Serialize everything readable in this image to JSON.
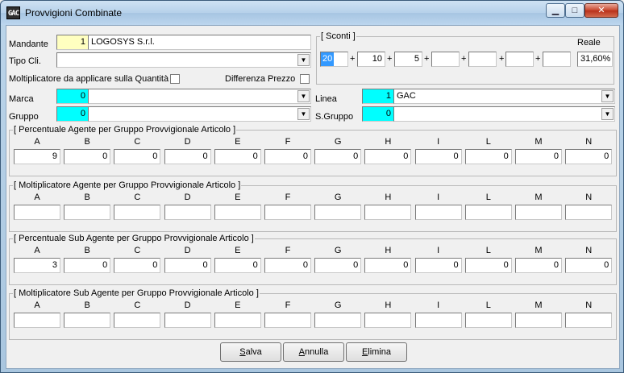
{
  "window": {
    "title": "Provvigioni Combinate",
    "icon_text": "GAC",
    "minimize_glyph": "▁",
    "maximize_glyph": "□",
    "close_glyph": "✕"
  },
  "mandante": {
    "label": "Mandante",
    "code": "1",
    "name": "LOGOSYS S.r.l."
  },
  "tipo_cli": {
    "label": "Tipo Cli.",
    "value": ""
  },
  "moltiplicatore_quantita": {
    "label": "Moltiplicatore da applicare sulla Quantità",
    "checked": false
  },
  "differenza_prezzo": {
    "label": "Differenza Prezzo",
    "checked": false
  },
  "sconti": {
    "title": "[ Sconti ]",
    "reale_label": "Reale",
    "values": [
      "20",
      "10",
      "5",
      "",
      "",
      "",
      ""
    ],
    "plus": "+",
    "reale_value": "31,60%"
  },
  "marca": {
    "label": "Marca",
    "code": "0",
    "name": ""
  },
  "linea": {
    "label": "Linea",
    "code": "1",
    "name": "GAC"
  },
  "gruppo": {
    "label": "Gruppo",
    "code": "0",
    "name": ""
  },
  "sgruppo": {
    "label": "S.Gruppo",
    "code": "0",
    "name": ""
  },
  "columns": [
    "A",
    "B",
    "C",
    "D",
    "E",
    "F",
    "G",
    "H",
    "I",
    "L",
    "M",
    "N"
  ],
  "groups": [
    {
      "title": "[ Percentuale Agente per Gruppo Provvigionale Articolo ]",
      "values": [
        "9",
        "0",
        "0",
        "0",
        "0",
        "0",
        "0",
        "0",
        "0",
        "0",
        "0",
        "0"
      ]
    },
    {
      "title": "[ Moltiplicatore Agente per Gruppo Provvigionale Articolo ]",
      "values": [
        "",
        "",
        "",
        "",
        "",
        "",
        "",
        "",
        "",
        "",
        "",
        ""
      ]
    },
    {
      "title": "[ Percentuale Sub Agente per Gruppo Provvigionale Articolo ]",
      "values": [
        "3",
        "0",
        "0",
        "0",
        "0",
        "0",
        "0",
        "0",
        "0",
        "0",
        "0",
        "0"
      ]
    },
    {
      "title": "[ Moltiplicatore Sub Agente per Gruppo Provvigionale Articolo ]",
      "values": [
        "",
        "",
        "",
        "",
        "",
        "",
        "",
        "",
        "",
        "",
        "",
        ""
      ]
    }
  ],
  "buttons": {
    "salva": {
      "mnemonic": "S",
      "rest": "alva"
    },
    "annulla": {
      "mnemonic": "A",
      "rest": "nnulla"
    },
    "elimina": {
      "mnemonic": "E",
      "rest": "limina"
    }
  },
  "icons": {
    "dropdown": "▼"
  }
}
